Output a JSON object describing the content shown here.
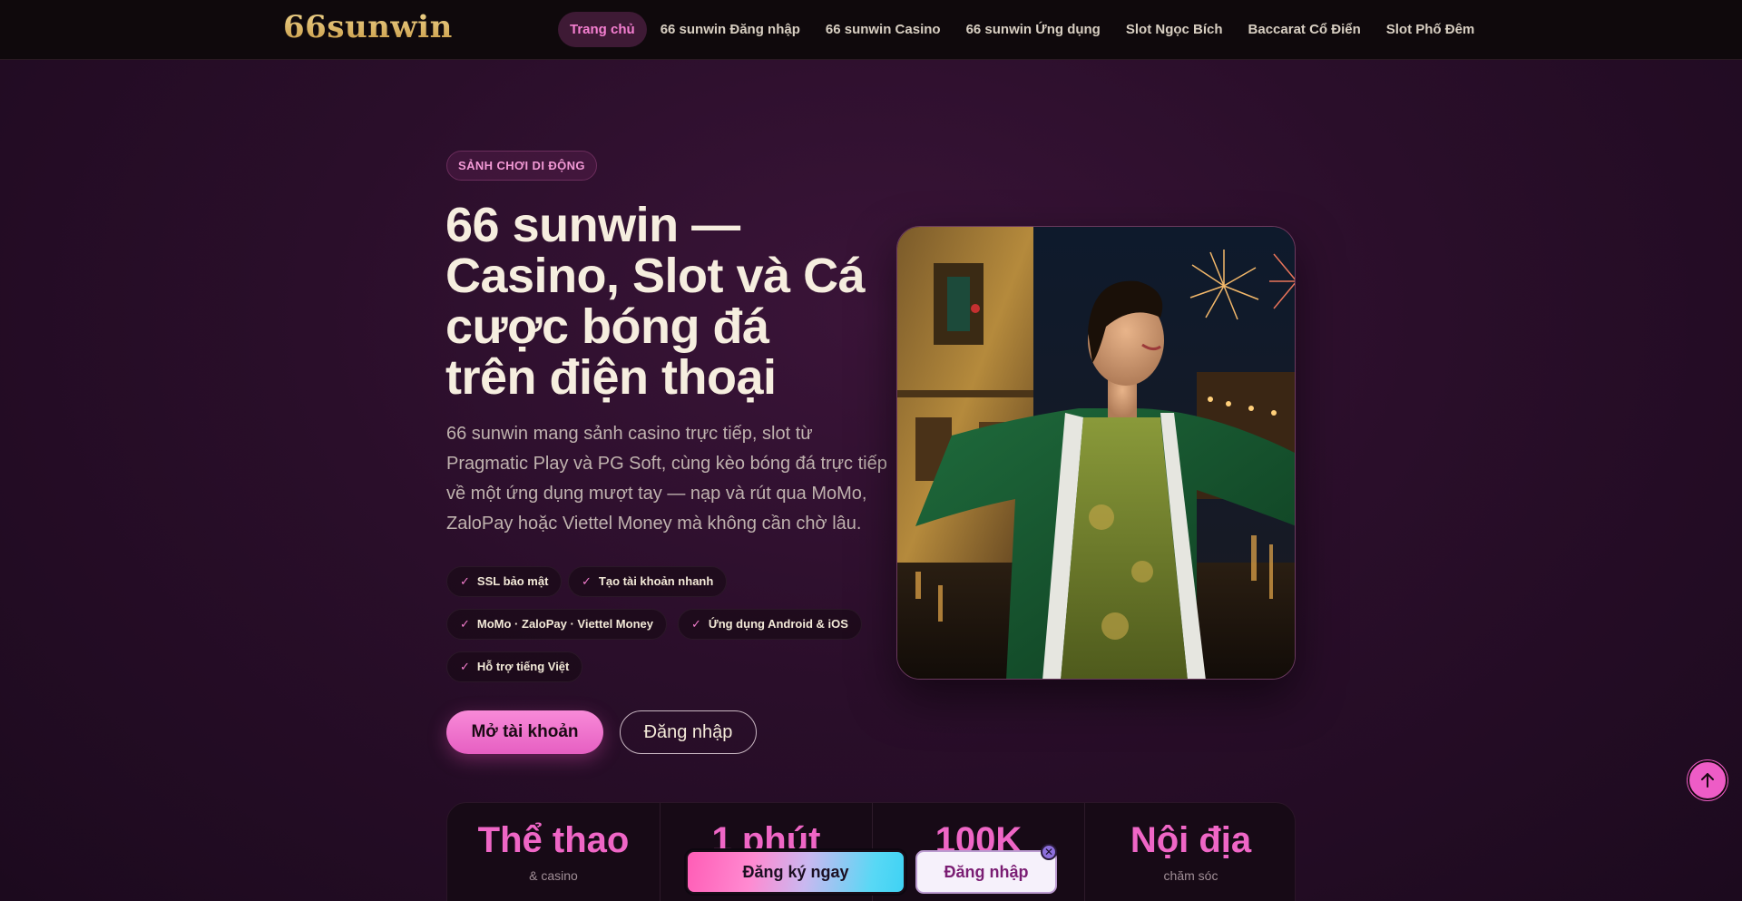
{
  "header": {
    "logo": "66sunwin",
    "nav": [
      {
        "label": "Trang chủ",
        "active": true
      },
      {
        "label": "66 sunwin Đăng nhập"
      },
      {
        "label": "66 sunwin Casino"
      },
      {
        "label": "66 sunwin Ứng dụng"
      },
      {
        "label": "Slot Ngọc Bích"
      },
      {
        "label": "Baccarat Cổ Điển"
      },
      {
        "label": "Slot Phố Đêm"
      }
    ]
  },
  "hero": {
    "eyebrow": "SẢNH CHƠI DI ĐỘNG",
    "title": "66 sunwin — Casino, Slot và Cá cược bóng đá trên điện thoại",
    "description": "66 sunwin mang sảnh casino trực tiếp, slot từ Pragmatic Play và PG Soft, cùng kèo bóng đá trực tiếp về một ứng dụng mượt tay — nạp và rút qua MoMo, ZaloPay hoặc Viettel Money mà không cần chờ lâu.",
    "check_mark": "✓",
    "features": [
      "SSL bảo mật",
      "Tạo tài khoản nhanh",
      "MoMo · ZaloPay · Viettel Money",
      "Ứng dụng Android & iOS",
      "Hỗ trợ tiếng Việt"
    ],
    "primary_cta": "Mở tài khoản",
    "secondary_cta": "Đăng nhập"
  },
  "stats": [
    {
      "value": "Thể thao",
      "label": "& casino"
    },
    {
      "value": "1 phút",
      "label": ""
    },
    {
      "value": "100K",
      "label": ""
    },
    {
      "value": "Nội địa",
      "label": "chăm sóc"
    }
  ],
  "floating_bar": {
    "register": "Đăng ký ngay",
    "login": "Đăng nhập",
    "close_symbol": "✕"
  },
  "colors": {
    "accent_pink": "#ef66c6",
    "gold_logo": "#d9b76a",
    "background": "#2a0e2a"
  },
  "icons": {
    "scroll_top": "arrow-up-icon"
  }
}
